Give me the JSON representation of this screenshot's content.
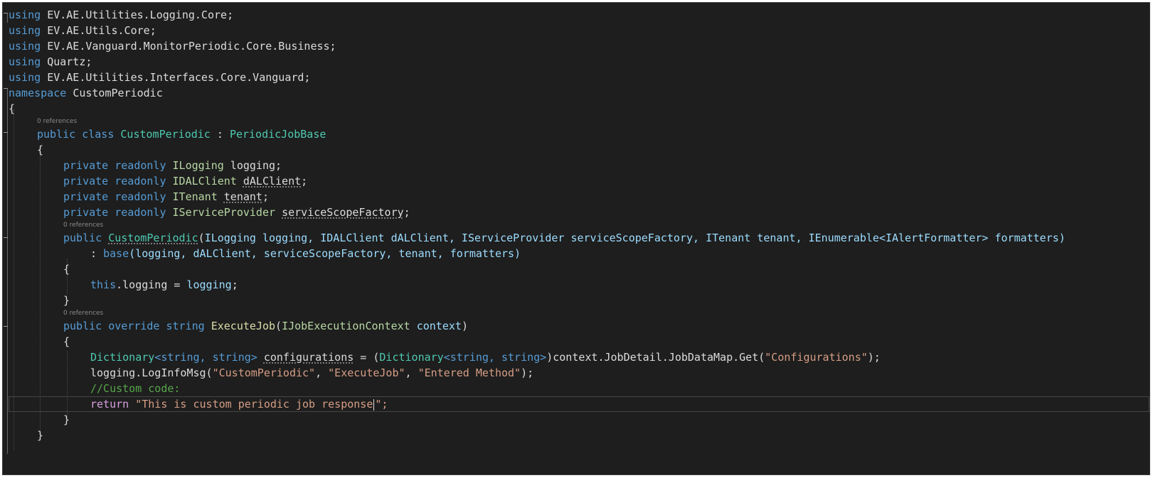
{
  "editor": {
    "usings": [
      "EV.AE.Utilities.Logging.Core",
      "EV.AE.Utils.Core",
      "EV.AE.Vanguard.MonitorPeriodic.Core.Business",
      "Quartz",
      "EV.AE.Utilities.Interfaces.Core.Vanguard"
    ],
    "kw": {
      "using": "using",
      "namespace": "namespace",
      "public": "public",
      "class": "class",
      "private": "private",
      "readonly": "readonly",
      "override": "override",
      "string": "string",
      "this": "this",
      "base": "base",
      "return": "return"
    },
    "namespace_name": "CustomPeriodic",
    "class_name": "CustomPeriodic",
    "base_class": "PeriodicJobBase",
    "lens_refs": "0 references",
    "fields": [
      {
        "type": "ILogging",
        "name": "logging"
      },
      {
        "type": "IDALClient",
        "name": "dALClient"
      },
      {
        "type": "ITenant",
        "name": "tenant"
      },
      {
        "type": "IServiceProvider",
        "name": "serviceScopeFactory"
      }
    ],
    "ctor": {
      "name": "CustomPeriodic",
      "params": "ILogging logging, IDALClient dALClient, IServiceProvider serviceScopeFactory, ITenant tenant, IEnumerable<IAlertFormatter> formatters)",
      "base_args": "(logging, dALClient, serviceScopeFactory, tenant, formatters)",
      "body_target": "logging",
      "body_value": "logging"
    },
    "method": {
      "return_type": "string",
      "name": "ExecuteJob",
      "param_type": "IJobExecutionContext",
      "param_name": "context"
    },
    "body": {
      "dict_type": "Dictionary",
      "generic_args": "<string, string>",
      "var_name": "configurations",
      "cast_tail": "context.JobDetail.JobDataMap.Get(",
      "config_key": "\"Configurations\"",
      "log_call": "logging.LogInfoMsg(",
      "log_arg1": "\"CustomPeriodic\"",
      "log_arg2": "\"ExecuteJob\"",
      "log_arg3": "\"Entered Method\"",
      "comment": "//Custom code:",
      "return_string": "\"This is custom periodic job response",
      "return_tail": "\";"
    }
  },
  "colors": {
    "background": "#1e1e1e",
    "keyword": "#569cd6",
    "control_keyword": "#d8a0df",
    "type": "#4ec9b0",
    "interface": "#b8d7a3",
    "method": "#dcdcaa",
    "string": "#d69d85",
    "comment": "#57a64a",
    "text": "#dcdcdc"
  }
}
